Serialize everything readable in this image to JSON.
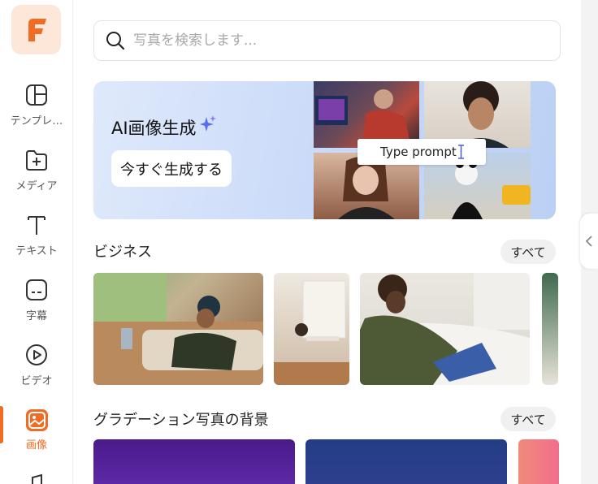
{
  "sidebar": {
    "items": [
      {
        "label": "テンプレ…",
        "icon": "template-icon",
        "active": false
      },
      {
        "label": "メディア",
        "icon": "media-folder-icon",
        "active": false
      },
      {
        "label": "テキスト",
        "icon": "text-icon",
        "active": false
      },
      {
        "label": "字幕",
        "icon": "subtitle-icon",
        "active": false
      },
      {
        "label": "ビデオ",
        "icon": "video-play-icon",
        "active": false
      },
      {
        "label": "画像",
        "icon": "image-icon",
        "active": true
      }
    ]
  },
  "search": {
    "placeholder": "写真を検索します..."
  },
  "banner": {
    "title": "AI画像生成",
    "button_label": "今すぐ生成する",
    "prompt_text": "Type prompt"
  },
  "sections": [
    {
      "title": "ビジネス",
      "all_label": "すべて"
    },
    {
      "title": "グラデーション写真の背景",
      "all_label": "すべて"
    }
  ],
  "colors": {
    "accent": "#f06b23",
    "logo_bg": "#fde7d8"
  }
}
